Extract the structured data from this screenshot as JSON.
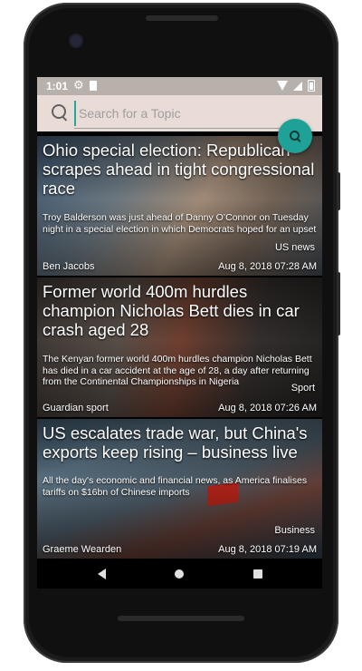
{
  "status_bar": {
    "time": "1:01"
  },
  "search": {
    "placeholder": "Search for a Topic"
  },
  "articles": [
    {
      "title": "Ohio special election: Republican scrapes ahead in tight congressional race",
      "description": "Troy Balderson was just ahead of Danny O’Connor on Tuesday night in a special election in which Democrats hoped for an upset",
      "category": "US news",
      "author": "Ben Jacobs",
      "date": "Aug 8, 2018 07:28 AM"
    },
    {
      "title": "Former world 400m hurdles champion Nicholas Bett dies in car crash aged 28",
      "description": "The Kenyan former world 400m hurdles champion Nicholas Bett has died in a car accident at the age of 28, a day after returning from the Continental Championships in Nigeria",
      "category": "Sport",
      "author": "Guardian sport",
      "date": "Aug 8, 2018 07:26 AM"
    },
    {
      "title": "US escalates trade war, but China's exports keep rising – business live",
      "description": "All the day's economic and financial news, as America finalises tariffs on $16bn of Chinese imports",
      "category": "Business",
      "author": "Graeme Wearden",
      "date": "Aug 8, 2018 07:19 AM"
    }
  ],
  "colors": {
    "accent": "#1fa198",
    "search_bar_bg": "#e9dcd6",
    "status_bar_bg": "#b7b0ab"
  }
}
